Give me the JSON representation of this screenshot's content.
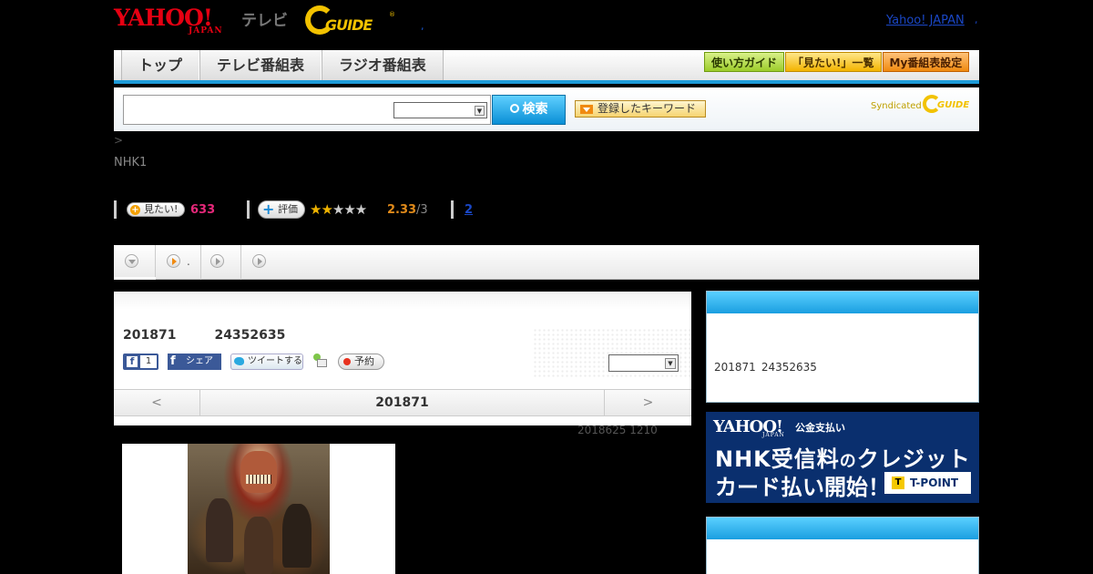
{
  "header": {
    "yahoo_logo": "YAHOO!",
    "yahoo_logo_sub": "JAPAN",
    "tv_label": "テレビ",
    "gguide_logo": "GUIDE",
    "gguide_reg": "®",
    "dot_sep": ",",
    "yahoo_japan_link": "Yahoo! JAPAN",
    "link_sep": ","
  },
  "nav": {
    "tabs": [
      {
        "label": "トップ"
      },
      {
        "label": "テレビ番組表"
      },
      {
        "label": "ラジオ番組表"
      }
    ],
    "guide_btn": "使い方ガイド",
    "mitai_list_btn": "「見たい!」一覧",
    "my_program_btn": "My番組表設定"
  },
  "search": {
    "input_value": "",
    "select_value": "",
    "button_label": "検索",
    "keyword_button": "登録したキーワード",
    "syndicated_label": "Syndicated",
    "syndicated_logo": "GUIDE"
  },
  "breadcrumb": {
    "separator": ">"
  },
  "program": {
    "channel": "NHK1",
    "mitai_label": "見たい!",
    "mitai_count": "633",
    "rate_label": "評価",
    "stars_on": "★★",
    "stars_off": "★★★",
    "rating": "2.33",
    "rating_max": "/3",
    "review_count": "2",
    "date": "201871",
    "time": "24352635",
    "fb_like_count": "1",
    "fb_share_label": "シェア",
    "tweet_label": "ツイートする",
    "yoyaku_label": "予約",
    "panel_select_value": "",
    "pager_prev": "<",
    "pager_center": "201871",
    "pager_next": ">",
    "updated": "2018625  1210"
  },
  "subnav": {
    "tab2_text": "."
  },
  "sidebar": {
    "box1_date": "201871",
    "box1_time": "24352635",
    "ad": {
      "logo": "YAHOO!",
      "logo_sub": "JAPAN",
      "label": "公金支払い",
      "line1_a": "NHK受信料",
      "line1_b": "の",
      "line1_c": "クレジット",
      "line2": "カード払い開始！",
      "tpoint_logo": "T",
      "tpoint": "T-POINT"
    }
  },
  "colors": {
    "accent_blue": "#1e9bd8",
    "yahoo_red": "#e60012",
    "gguide_yellow": "#f2c200",
    "mitai_pink": "#e6287a",
    "rating_orange": "#e08a1a"
  }
}
